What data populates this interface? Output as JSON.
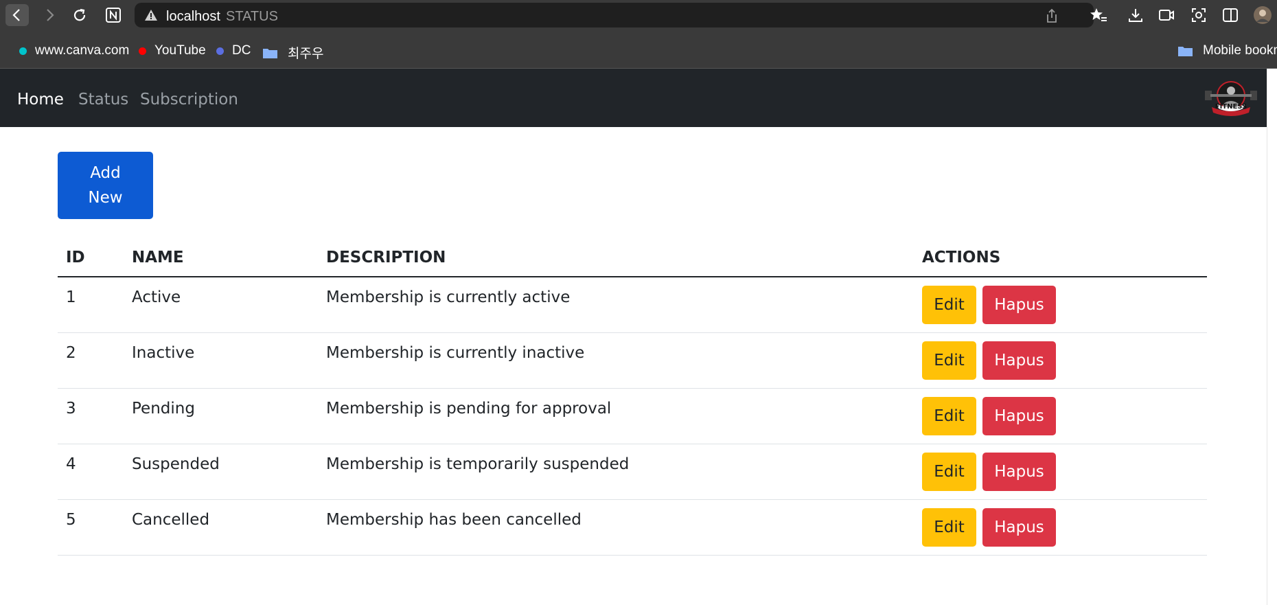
{
  "browser": {
    "address_host": "localhost",
    "address_title": "STATUS",
    "icons": [
      "back-icon",
      "forward-icon",
      "reload-icon",
      "notion-icon",
      "warning-icon",
      "share-icon",
      "favorites-icon",
      "download-icon",
      "video-icon",
      "screenshot-icon",
      "split-view-icon",
      "profile-avatar"
    ]
  },
  "bookmarks": {
    "items": [
      {
        "label": "www.canva.com",
        "color": "#00c4cc"
      },
      {
        "label": "YouTube",
        "color": "#ff0000"
      },
      {
        "label": "DC",
        "color": "#5b6ee1"
      },
      {
        "label": "최주우",
        "color": "#8ab4f8"
      }
    ],
    "mobile": "Mobile bookmarks"
  },
  "navbar": {
    "links": [
      {
        "label": "Home",
        "active": true
      },
      {
        "label": "Status",
        "active": false
      },
      {
        "label": "Subscription",
        "active": false
      }
    ],
    "logo_text": "FITNESS"
  },
  "main": {
    "add_button": {
      "line1": "Add",
      "line2": "New"
    },
    "table": {
      "headers": [
        "ID",
        "NAME",
        "DESCRIPTION",
        "ACTIONS"
      ],
      "rows": [
        {
          "id": "1",
          "name": "Active",
          "description": "Membership is currently active"
        },
        {
          "id": "2",
          "name": "Inactive",
          "description": "Membership is currently inactive"
        },
        {
          "id": "3",
          "name": "Pending",
          "description": "Membership is pending for approval"
        },
        {
          "id": "4",
          "name": "Suspended",
          "description": "Membership is temporarily suspended"
        },
        {
          "id": "5",
          "name": "Cancelled",
          "description": "Membership has been cancelled"
        }
      ],
      "edit_label": "Edit",
      "delete_label": "Hapus"
    }
  },
  "colors": {
    "primary": "#0d5bd3",
    "warning": "#ffc107",
    "danger": "#dc3545",
    "navbar_bg": "#212529"
  }
}
